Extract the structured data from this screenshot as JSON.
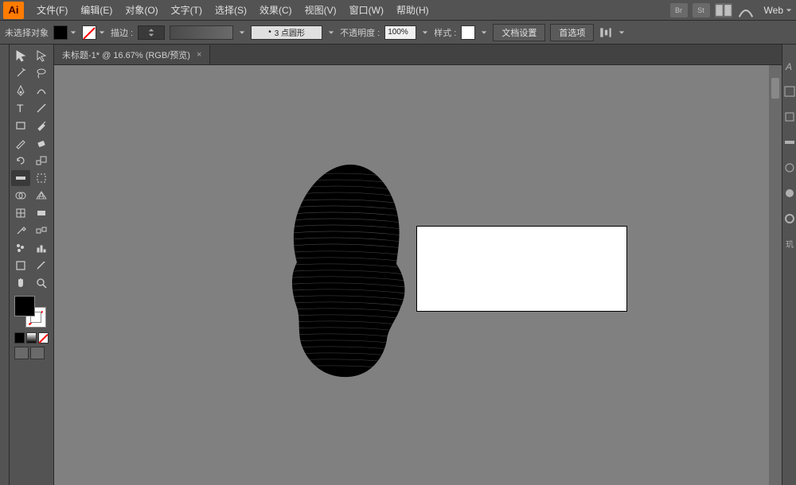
{
  "app": {
    "icon_text": "Ai"
  },
  "menu": {
    "file": "文件(F)",
    "edit": "编辑(E)",
    "object": "对象(O)",
    "type": "文字(T)",
    "select": "选择(S)",
    "effect": "效果(C)",
    "view": "视图(V)",
    "window": "窗口(W)",
    "help": "帮助(H)"
  },
  "menubar_right": {
    "br": "Br",
    "st": "St",
    "workspace": "Web"
  },
  "optbar": {
    "no_selection": "未选择对象",
    "stroke_label": "描边 :",
    "stroke_weight": "",
    "profile_label": "3 点圆形",
    "opacity_label": "不透明度 :",
    "opacity_value": "100%",
    "style_label": "样式 :",
    "doc_setup": "文档设置",
    "preferences": "首选项"
  },
  "tab": {
    "title": "未标题-1* @ 16.67% (RGB/预览)",
    "close": "×"
  },
  "tools": {
    "selection": "selection",
    "direct": "direct-selection",
    "wand": "magic-wand",
    "lasso": "lasso",
    "pen": "pen",
    "curvature": "curvature",
    "type": "type",
    "line": "line",
    "rect": "rectangle",
    "brush": "paintbrush",
    "pencil": "pencil",
    "eraser": "eraser",
    "rotate": "rotate",
    "reflect": "reflect",
    "warp": "width",
    "free": "free-transform",
    "shape": "shape-builder",
    "perspective": "perspective-grid",
    "mesh": "mesh",
    "gradient": "gradient",
    "eyedrop": "eyedropper",
    "blend": "blend",
    "symbol": "symbol-sprayer",
    "graph": "column-graph",
    "artboard": "artboard",
    "slice": "slice",
    "hand": "hand",
    "zoom": "zoom"
  },
  "right_panel": {
    "icons": [
      "color-icon",
      "swatches-icon",
      "stroke-icon",
      "brushes-icon",
      "symbols-icon",
      "appearance-icon",
      "graphic-styles-icon",
      "layers-icon"
    ]
  }
}
